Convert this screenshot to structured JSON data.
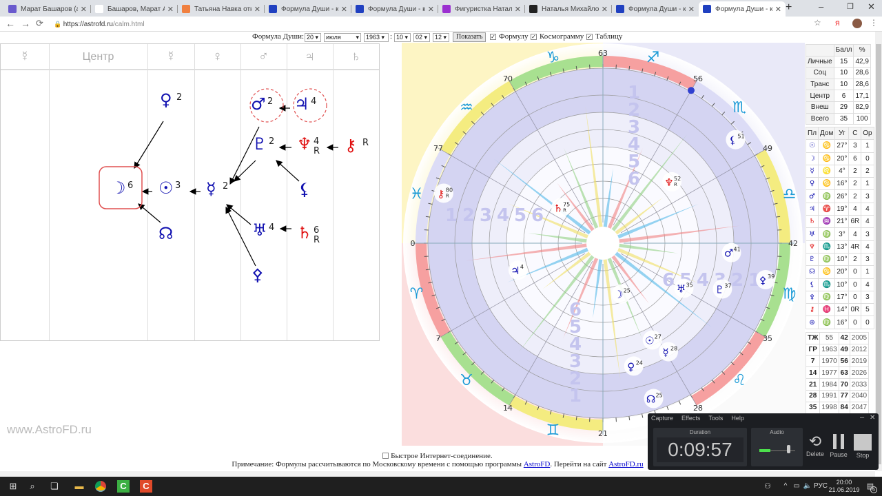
{
  "browser": {
    "tabs": [
      {
        "title": "Марат Башаров (акте",
        "icon": "tv-icon",
        "color": "#6a5acd"
      },
      {
        "title": "Башаров, Марат Али",
        "icon": "wikipedia-icon",
        "color": "#fff"
      },
      {
        "title": "Татьяна Навка отказа",
        "icon": "news-icon",
        "color": "#f08040"
      },
      {
        "title": "Формула Души - кале",
        "icon": "astrofd-icon",
        "color": "#2040c0"
      },
      {
        "title": "Формула Души - кале",
        "icon": "astrofd-icon",
        "color": "#2040c0"
      },
      {
        "title": "Фигуристка Наталья М",
        "icon": "heart-icon",
        "color": "#9b30d0"
      },
      {
        "title": "Наталья Михайлова -",
        "icon": "fb-icon",
        "color": "#222"
      },
      {
        "title": "Формула Души - кале",
        "icon": "astrofd-icon",
        "color": "#2040c0"
      },
      {
        "title": "Формула Души - кале",
        "icon": "astrofd-icon",
        "color": "#2040c0",
        "active": true
      }
    ],
    "url_prefix": "https://astrofd.ru",
    "url_path": "/calm.html",
    "yandex": "Я"
  },
  "form": {
    "label": "Формула Души:",
    "day": "20",
    "month": "июля",
    "year": "1963",
    "sep": ":",
    "hour": "10",
    "minute": "02",
    "tz": "12",
    "show_button": "Показать",
    "cb_formula": "Формулу",
    "cb_cosmogram": "Космограмму",
    "cb_table": "Таблицу"
  },
  "formula": {
    "headers": [
      "☿",
      "Центр",
      "☿",
      "♀",
      "♂",
      "♃",
      "♄"
    ],
    "nodes": [
      {
        "g": "♀",
        "n": "2"
      },
      {
        "g": "☽",
        "n": "6"
      },
      {
        "g": "☉",
        "n": "3"
      },
      {
        "g": "☊",
        "n": ""
      },
      {
        "g": "☿",
        "n": "2"
      },
      {
        "g": "♂",
        "n": "2"
      },
      {
        "g": "♃",
        "n": "4"
      },
      {
        "g": "♇",
        "n": "2"
      },
      {
        "g": "♆",
        "n": "4",
        "r": "R"
      },
      {
        "g": "⚷",
        "n": "",
        "r": "R"
      },
      {
        "g": "⚸",
        "n": ""
      },
      {
        "g": "♅",
        "n": "4"
      },
      {
        "g": "♄",
        "n": "6",
        "r": "R"
      },
      {
        "g": "⚴",
        "n": ""
      }
    ]
  },
  "watermark": "www.AstroFD.ru",
  "cosmogram": {
    "degree_labels": [
      "0",
      "7",
      "14",
      "21",
      "28",
      "35",
      "42",
      "49",
      "56",
      "63",
      "70",
      "77"
    ],
    "signs": [
      "♈",
      "♉",
      "♊",
      "♋",
      "♌",
      "♍",
      "♎",
      "♏",
      "♐",
      "♑",
      "♒",
      "♓"
    ],
    "sign_color": "#1a9ad6",
    "planets": [
      {
        "g": "☽",
        "deg": 25,
        "label": "25"
      },
      {
        "g": "☉",
        "deg": 27,
        "label": "27"
      },
      {
        "g": "☿",
        "deg": 28,
        "label": "28"
      },
      {
        "g": "♀",
        "deg": 24,
        "label": "24"
      },
      {
        "g": "♂",
        "deg": 41,
        "label": "41"
      },
      {
        "g": "♃",
        "deg": 4,
        "label": "4"
      },
      {
        "g": "♄",
        "deg": 75,
        "label": "75",
        "r": "R",
        "red": true
      },
      {
        "g": "♅",
        "deg": 35,
        "label": "35"
      },
      {
        "g": "♆",
        "deg": 52,
        "label": "52",
        "r": "R",
        "red": true
      },
      {
        "g": "♇",
        "deg": 37,
        "label": "37"
      },
      {
        "g": "☊",
        "deg": 25,
        "label": "25"
      },
      {
        "g": "⚸",
        "deg": 51,
        "label": "51"
      },
      {
        "g": "⚴",
        "deg": 39,
        "label": "39"
      },
      {
        "g": "⚷",
        "deg": 80,
        "label": "80",
        "r": "R",
        "red": true
      }
    ],
    "marker_deg": 56,
    "ring_numbers": [
      "1",
      "2",
      "3",
      "4",
      "5",
      "6"
    ]
  },
  "score_table": {
    "headers": [
      "",
      "Балл",
      "%"
    ],
    "rows": [
      [
        "Личные",
        "15",
        "42,9"
      ],
      [
        "Соц",
        "10",
        "28,6"
      ],
      [
        "Транс",
        "10",
        "28,6"
      ],
      [
        "Центр",
        "6",
        "17,1"
      ],
      [
        "Внеш",
        "29",
        "82,9"
      ],
      [
        "Всего",
        "35",
        "100"
      ]
    ]
  },
  "planet_table": {
    "headers": [
      "Пл",
      "Дом",
      "Уг",
      "С",
      "Ор"
    ],
    "rows": [
      [
        "☉",
        "♋",
        "27°",
        "3",
        "1"
      ],
      [
        "☽",
        "♋",
        "20°",
        "6",
        "0"
      ],
      [
        "☿",
        "♌",
        "4°",
        "2",
        "2"
      ],
      [
        "♀",
        "♋",
        "16°",
        "2",
        "1"
      ],
      [
        "♂",
        "♍",
        "26°",
        "2",
        "3"
      ],
      [
        "♃",
        "♈",
        "19°",
        "4",
        "4"
      ],
      [
        "♄",
        "♒",
        "21°",
        "6R",
        "4"
      ],
      [
        "♅",
        "♍",
        "3°",
        "4",
        "3"
      ],
      [
        "♆",
        "♏",
        "13°",
        "4R",
        "4"
      ],
      [
        "♇",
        "♍",
        "10°",
        "2",
        "3"
      ],
      [
        "☊",
        "♋",
        "20°",
        "0",
        "1"
      ],
      [
        "⚸",
        "♏",
        "10°",
        "0",
        "4"
      ],
      [
        "⚴",
        "♍",
        "17°",
        "0",
        "3"
      ],
      [
        "⚷",
        "♓",
        "14°",
        "0R",
        "5"
      ],
      [
        "⊕",
        "♍",
        "16°",
        "0",
        "0"
      ]
    ],
    "red_rows": [
      6,
      8,
      13
    ]
  },
  "years_table": {
    "rows": [
      [
        "ТЖ",
        "55",
        "42",
        "2005"
      ],
      [
        "ГР",
        "1963",
        "49",
        "2012"
      ],
      [
        "7",
        "1970",
        "56",
        "2019"
      ],
      [
        "14",
        "1977",
        "63",
        "2026"
      ],
      [
        "21",
        "1984",
        "70",
        "2033"
      ],
      [
        "28",
        "1991",
        "77",
        "2040"
      ],
      [
        "35",
        "1998",
        "84",
        "2047"
      ]
    ]
  },
  "notes": {
    "fast_connection": "Быстрое Интернет-соединение.",
    "note_prefix": "Примечание: Формулы рассчитываются по Московскому времени с помощью программы ",
    "link1": "AstroFD",
    "note_mid": ". Перейти на сайт ",
    "link2": "AstroFD.ru"
  },
  "capture": {
    "menu": [
      "Capture",
      "Effects",
      "Tools",
      "Help"
    ],
    "duration_label": "Duration",
    "duration": "0:09:57",
    "audio_label": "Audio",
    "audio_level": 0.3,
    "delete": "Delete",
    "pause": "Pause",
    "stop": "Stop"
  },
  "taskbar": {
    "lang": "РУС",
    "time": "20:00",
    "date": "21.06.2019",
    "notifications": "5"
  }
}
